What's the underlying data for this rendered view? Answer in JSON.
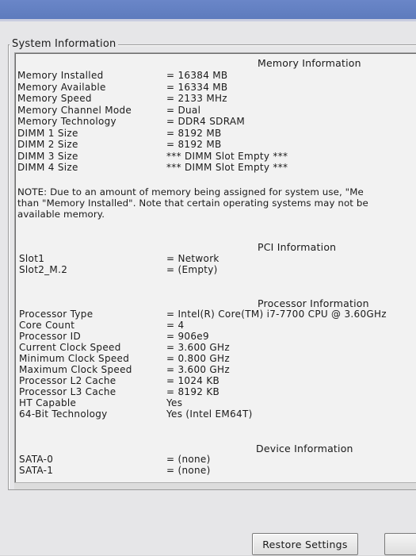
{
  "window": {
    "group_title": "System Information",
    "restore_button": "Restore Settings"
  },
  "memory": {
    "heading": "Memory Information",
    "rows": [
      {
        "label": "Memory Installed",
        "value": "= 16384 MB"
      },
      {
        "label": "Memory Available",
        "value": "= 16334 MB"
      },
      {
        "label": "Memory Speed",
        "value": "= 2133 MHz"
      },
      {
        "label": "Memory Channel Mode",
        "value": "= Dual"
      },
      {
        "label": "Memory Technology",
        "value": "= DDR4 SDRAM"
      },
      {
        "label": "DIMM 1 Size",
        "value": "= 8192 MB"
      },
      {
        "label": "DIMM 2 Size",
        "value": "= 8192 MB"
      },
      {
        "label": "DIMM 3 Size",
        "value": "*** DIMM Slot Empty ***"
      },
      {
        "label": "DIMM 4 Size",
        "value": "*** DIMM Slot Empty ***"
      }
    ]
  },
  "note": {
    "line1": "NOTE: Due to an amount of memory being assigned for system use, \"Me",
    "line2": "than \"Memory Installed\". Note that certain operating systems may not be",
    "line3": "available memory."
  },
  "pci": {
    "heading": "PCI Information",
    "rows": [
      {
        "label": "Slot1",
        "value": "= Network"
      },
      {
        "label": "Slot2_M.2",
        "value": "= (Empty)"
      }
    ]
  },
  "processor": {
    "heading": "Processor Information",
    "rows": [
      {
        "label": "Processor Type",
        "value": "= Intel(R) Core(TM) i7-7700 CPU @ 3.60GHz"
      },
      {
        "label": "Core Count",
        "value": "= 4"
      },
      {
        "label": "Processor ID",
        "value": "= 906e9"
      },
      {
        "label": "Current Clock Speed",
        "value": "= 3.600 GHz"
      },
      {
        "label": "Minimum Clock Speed",
        "value": "= 0.800 GHz"
      },
      {
        "label": "Maximum Clock Speed",
        "value": "= 3.600 GHz"
      },
      {
        "label": "Processor L2 Cache",
        "value": "= 1024 KB"
      },
      {
        "label": "Processor L3 Cache",
        "value": "= 8192 KB"
      },
      {
        "label": "HT Capable",
        "value": "Yes"
      },
      {
        "label": "64-Bit Technology",
        "value": "Yes (Intel EM64T)"
      }
    ]
  },
  "device": {
    "heading": "Device Information",
    "rows": [
      {
        "label": "SATA-0",
        "value": "= (none)"
      },
      {
        "label": "SATA-1",
        "value": "= (none)"
      }
    ]
  }
}
